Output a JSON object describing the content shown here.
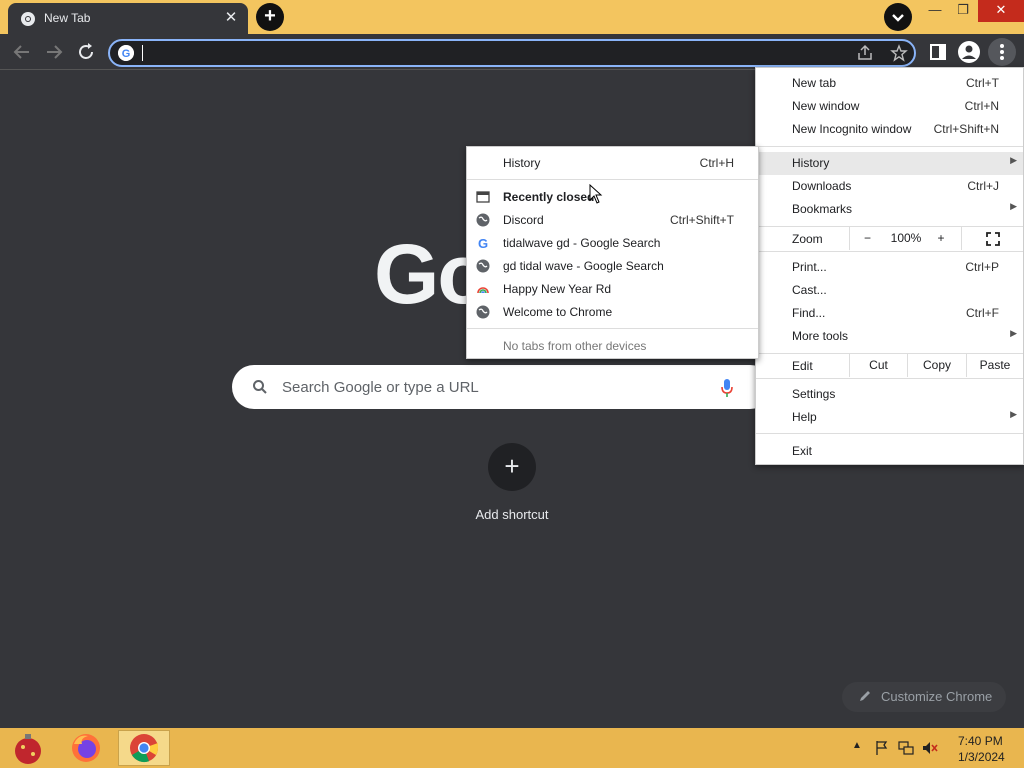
{
  "window": {
    "tab_title": "New Tab",
    "minimize": "—",
    "restore": "❐",
    "close": "✕"
  },
  "toolbar": {
    "omnibox_value": ""
  },
  "ntp": {
    "logo_text": "Go",
    "search_placeholder": "Search Google or type a URL",
    "add_shortcut_label": "Add shortcut",
    "customize_label": "Customize Chrome"
  },
  "main_menu": {
    "new_tab": {
      "label": "New tab",
      "shortcut": "Ctrl+T"
    },
    "new_window": {
      "label": "New window",
      "shortcut": "Ctrl+N"
    },
    "new_incognito": {
      "label": "New Incognito window",
      "shortcut": "Ctrl+Shift+N"
    },
    "history": {
      "label": "History"
    },
    "downloads": {
      "label": "Downloads",
      "shortcut": "Ctrl+J"
    },
    "bookmarks": {
      "label": "Bookmarks"
    },
    "zoom": {
      "label": "Zoom",
      "minus": "−",
      "value": "100%",
      "plus": "+"
    },
    "print": {
      "label": "Print...",
      "shortcut": "Ctrl+P"
    },
    "cast": {
      "label": "Cast..."
    },
    "find": {
      "label": "Find...",
      "shortcut": "Ctrl+F"
    },
    "more_tools": {
      "label": "More tools"
    },
    "edit": {
      "label": "Edit",
      "cut": "Cut",
      "copy": "Copy",
      "paste": "Paste"
    },
    "settings": {
      "label": "Settings"
    },
    "help": {
      "label": "Help"
    },
    "exit": {
      "label": "Exit"
    }
  },
  "history_menu": {
    "history": {
      "label": "History",
      "shortcut": "Ctrl+H"
    },
    "recently_closed": "Recently closed",
    "items": [
      {
        "label": "Discord",
        "shortcut": "Ctrl+Shift+T",
        "icon": "globe-icon"
      },
      {
        "label": "tidalwave gd - Google Search",
        "shortcut": "",
        "icon": "google-icon"
      },
      {
        "label": "gd tidal wave - Google Search",
        "shortcut": "",
        "icon": "globe-icon"
      },
      {
        "label": "Happy New Year Rd",
        "shortcut": "",
        "icon": "rainbow-icon"
      },
      {
        "label": "Welcome to Chrome",
        "shortcut": "",
        "icon": "globe-icon"
      }
    ],
    "no_devices": "No tabs from other devices"
  },
  "taskbar": {
    "time": "7:40 PM",
    "date": "1/3/2024"
  },
  "colors": {
    "tabstrip": "#f3c55f",
    "page_bg": "#35363a",
    "taskbar": "#e9b64f",
    "focus_ring": "#8ab4f8"
  }
}
